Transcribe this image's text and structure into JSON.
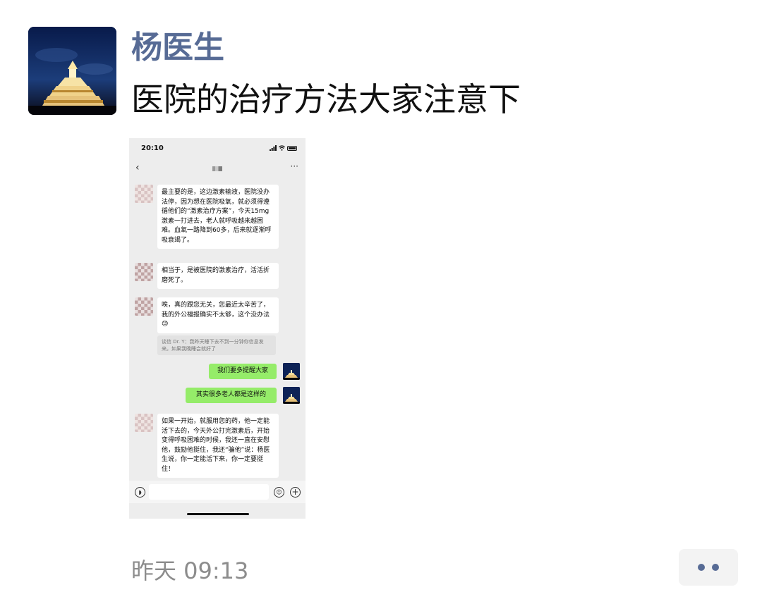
{
  "post": {
    "author": "杨医生",
    "text": "医院的治疗方法大家注意下",
    "time": "昨天 09:13",
    "more_icon": "ellipsis-icon"
  },
  "screenshot": {
    "status_time": "20:10",
    "messages": [
      {
        "side": "received",
        "text": "最主要的是，这边激素输液，医院没办法停，因为想在医院吸氧，就必须得遵循他们的“激素治疗方案”，今天15mg激素一打进去，老人就呼吸越来越困难。血氧一路降到60多，后来就逐渐呼吸衰竭了。"
      },
      {
        "side": "received",
        "text": "相当于，是被医院的激素治疗，活活折磨死了。"
      },
      {
        "side": "received",
        "text": "唉，真的跟您无关，您最近太辛苦了，我的外公福报确实不太够，这个没办法😓"
      },
      {
        "side": "quote",
        "text": "谈信 Dr. Y：我昨天睡下去不到一分钟你信息发来。如果我晚睡会就好了"
      },
      {
        "side": "sent",
        "text": "我们要多提醒大家"
      },
      {
        "side": "sent",
        "text": "其实很多老人都是这样的"
      },
      {
        "side": "received",
        "text": "如果一开始，就服用您的药，他一定能活下去的，今天外公打完激素后，开始变得呼吸困难的时候，我还一直在安慰他，鼓励他挺住，我还“骗他”说：杨医生说，你一定能活下来，你一定要挺住！"
      }
    ]
  }
}
